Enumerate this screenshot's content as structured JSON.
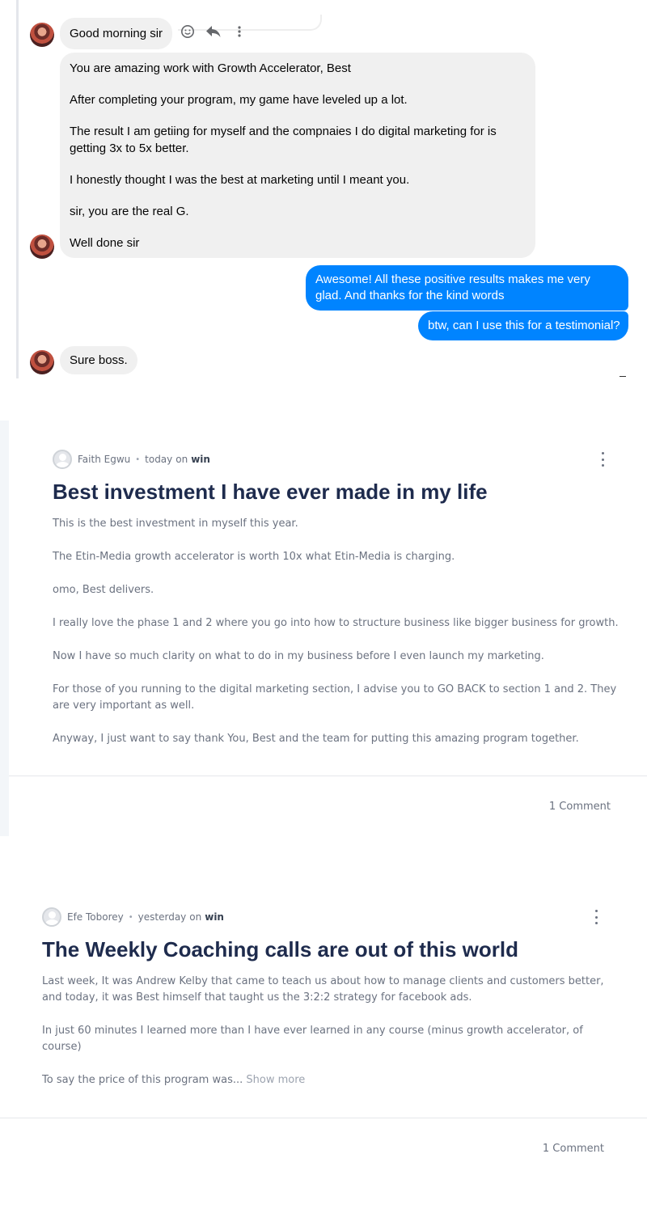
{
  "chat": {
    "greeting": "Good morning sir",
    "long_message": [
      "You are amazing work with Growth Accelerator, Best",
      "After completing your program, my game have leveled up a lot.",
      "The result I am getiing for myself and the compnaies I do digital marketing for is getting 3x to 5x better.",
      "I honestly thought I was the best at marketing until I meant you.",
      "sir, you are the real G.",
      "Well done sir"
    ],
    "reply_1": "Awesome! All these positive results makes me very glad. And thanks for the kind  words",
    "reply_2": "btw, can I use this for a testimonial?",
    "final_message": "Sure boss.",
    "incoming_bubble_color": "#f0f0f0",
    "outgoing_bubble_color": "#0084ff",
    "tool_icons": [
      "smiley-icon",
      "reply-icon",
      "more-options-icon"
    ]
  },
  "posts": [
    {
      "author": "Faith Egwu",
      "time": "today",
      "on_label": "on",
      "space": "win",
      "title": "Best investment I have ever made in my life",
      "paragraphs": [
        "This is the best investment in myself this year.",
        "The Etin-Media growth accelerator is worth 10x what Etin-Media is charging.",
        "omo, Best delivers.",
        "I really love the phase 1 and 2 where you go into how to structure business like bigger business for growth.",
        "Now I have so much clarity on what to do in my business before I even launch my marketing.",
        "For those of you running to the digital marketing section, I advise you to GO BACK to section 1 and 2. They are very important as well.",
        "Anyway, I just want to say thank You, Best and the team for putting this amazing program together."
      ],
      "comments": "1 Comment"
    },
    {
      "author": "Efe Toborey",
      "time": "yesterday",
      "on_label": "on",
      "space": "win",
      "title": "The Weekly Coaching calls are out of this world",
      "paragraphs": [
        "Last week, It was Andrew Kelby that came to teach us about how to manage clients and customers better, and today, it was Best himself that taught us the 3:2:2 strategy for facebook ads.",
        "In just 60 minutes I learned more than I have ever learned in any course (minus growth accelerator, of course)",
        "To say the price of this program was..."
      ],
      "show_more": "Show more",
      "comments": "1 Comment"
    }
  ],
  "colors": {
    "title": "#1e2b4d",
    "body_text": "#6b7280"
  }
}
